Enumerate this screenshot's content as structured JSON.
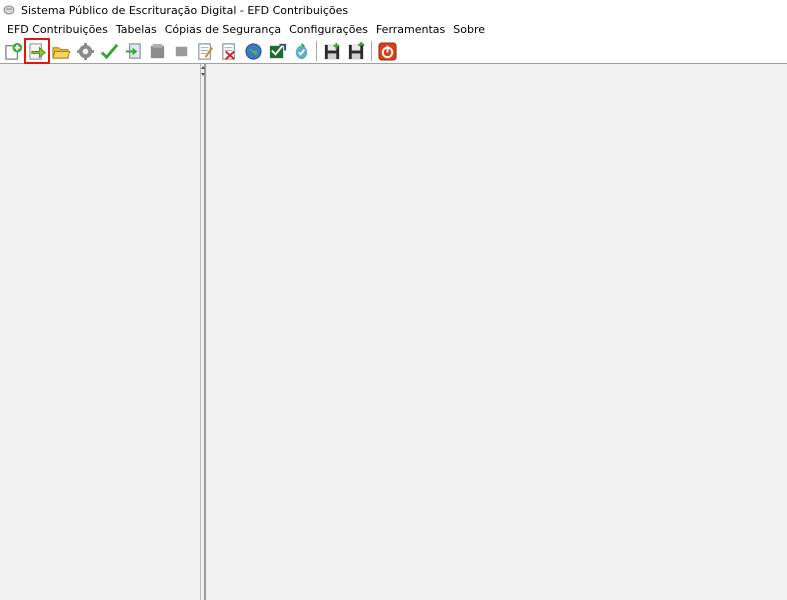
{
  "window": {
    "title": "Sistema Público de Escrituração Digital - EFD Contribuições"
  },
  "menu": [
    {
      "label": "EFD Contribuições"
    },
    {
      "label": "Tabelas"
    },
    {
      "label": "Cópias de Segurança"
    },
    {
      "label": "Configurações"
    },
    {
      "label": "Ferramentas"
    },
    {
      "label": "Sobre"
    }
  ],
  "toolbar": {
    "buttons": [
      "new-file-icon",
      "import-arrow-icon",
      "open-folder-icon",
      "gear-icon",
      "validate-check-icon",
      "edit-document-icon",
      "print-icon",
      "stop-icon",
      "sign-document-icon",
      "remove-signature-icon",
      "globe-icon",
      "transmit-icon",
      "receipt-icon",
      "save-backup-icon",
      "restore-backup-icon",
      "exit-power-icon"
    ],
    "highlighted": "import-arrow-icon",
    "highlight_color": "#e01414"
  }
}
